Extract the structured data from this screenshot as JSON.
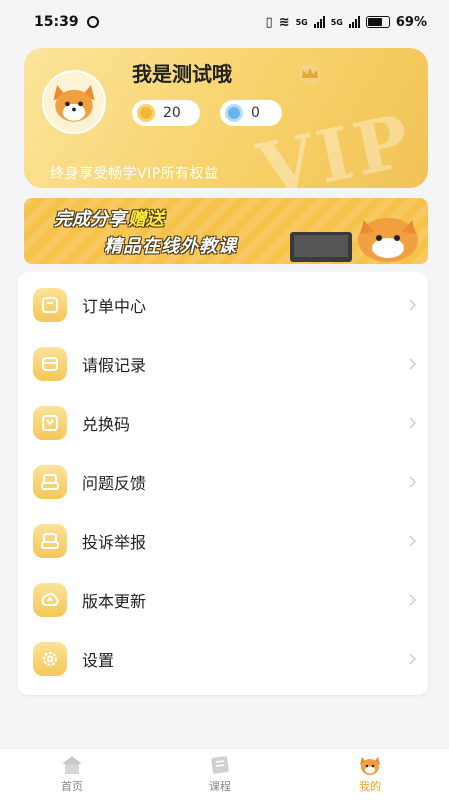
{
  "status_bar": {
    "time": "15:39",
    "network": "5G",
    "battery": "69%"
  },
  "vip_card": {
    "user_name": "我是测试哦",
    "coins": "20",
    "gems": "0",
    "watermark": "VIP",
    "description": "终身享受畅学VIP所有权益"
  },
  "promo": {
    "line1_prefix": "完成分享",
    "line1_highlight": "赠送",
    "line2": "精品在线外教课"
  },
  "menu": {
    "items": [
      {
        "label": "订单中心",
        "icon": "order-icon"
      },
      {
        "label": "请假记录",
        "icon": "leave-record-icon"
      },
      {
        "label": "兑换码",
        "icon": "redeem-code-icon"
      },
      {
        "label": "问题反馈",
        "icon": "feedback-icon"
      },
      {
        "label": "投诉举报",
        "icon": "complaint-icon"
      },
      {
        "label": "版本更新",
        "icon": "update-icon"
      },
      {
        "label": "设置",
        "icon": "settings-icon"
      }
    ]
  },
  "tabbar": {
    "tabs": [
      {
        "label": "首页",
        "icon": "home-icon"
      },
      {
        "label": "课程",
        "icon": "course-icon"
      },
      {
        "label": "我的",
        "icon": "mine-fox-icon"
      }
    ],
    "active": "我的"
  },
  "colors": {
    "accent": "#f4c757",
    "active_tab": "#e8a21e",
    "background": "#f5f5f7"
  }
}
